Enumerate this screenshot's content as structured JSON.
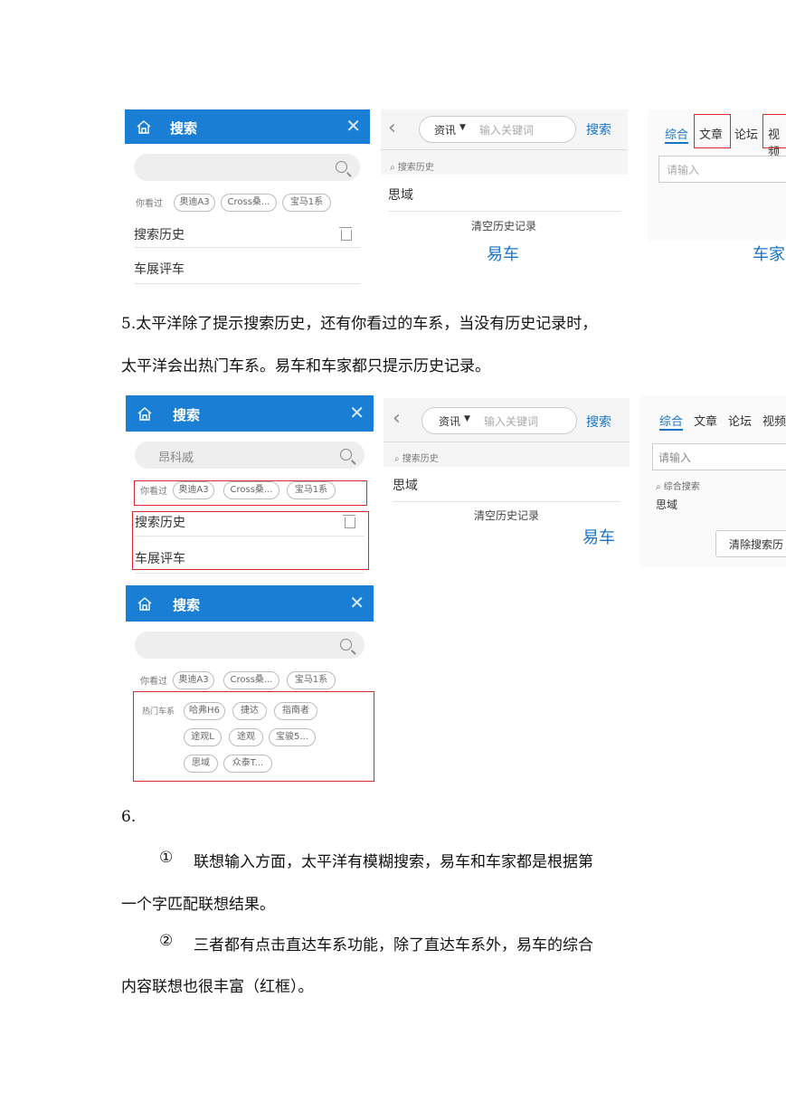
{
  "fig1": {
    "pcauto": {
      "title": "搜索",
      "seen_label": "你看过",
      "chips": [
        "奥迪A3",
        "Cross桑...",
        "宝马1系"
      ],
      "history_label": "搜索历史",
      "history_item": "车展评车"
    },
    "yiche": {
      "channel": "资讯",
      "placeholder": "输入关键词",
      "search_btn": "搜索",
      "history_label": "搜索历史",
      "history_item": "思域",
      "clear": "清空历史记录",
      "caption": "易车"
    },
    "autohome": {
      "tabs": [
        "综合",
        "文章",
        "论坛",
        "视频"
      ],
      "placeholder": "请输入",
      "caption": "车家"
    }
  },
  "para5": {
    "line1": "5.太平洋除了提示搜索历史，还有你看过的车系，当没有历史记录时，",
    "line2": "太平洋会出热门车系。易车和车家都只提示历史记录。"
  },
  "fig2": {
    "pcauto": {
      "title": "搜索",
      "query": "昂科威",
      "seen_label": "你看过",
      "chips": [
        "奥迪A3",
        "Cross桑...",
        "宝马1系"
      ],
      "history_label": "搜索历史",
      "history_item": "车展评车"
    },
    "yiche": {
      "channel": "资讯",
      "placeholder": "输入关键词",
      "search_btn": "搜索",
      "history_label": "搜索历史",
      "history_item": "思域",
      "clear": "清空历史记录",
      "caption": "易车"
    },
    "autohome": {
      "tabs": [
        "综合",
        "文章",
        "论坛",
        "视频"
      ],
      "placeholder": "请输入",
      "history_label": "综合搜索",
      "history_item": "思域",
      "clear": "清除搜索历"
    },
    "pcauto_hot": {
      "title": "搜索",
      "seen_label": "你看过",
      "chips": [
        "奥迪A3",
        "Cross桑...",
        "宝马1系"
      ],
      "hot_label": "热门车系",
      "hot_chips": [
        "哈弗H6",
        "捷达",
        "指南者",
        "途观L",
        "途观",
        "宝骏5...",
        "思域",
        "众泰T..."
      ]
    }
  },
  "section6": {
    "num": "6.",
    "p1_mark": "①",
    "p1_line1": "联想输入方面，太平洋有模糊搜索，易车和车家都是根据第",
    "p1_line2": "一个字匹配联想结果。",
    "p2_mark": "②",
    "p2_line1": "三者都有点击直达车系功能，除了直达车系外，易车的综合",
    "p2_line2": "内容联想也很丰富（红框）。"
  },
  "colors": {
    "accent": "#1a7fd4",
    "red": "#d62b2b",
    "link": "#1a73c6"
  }
}
